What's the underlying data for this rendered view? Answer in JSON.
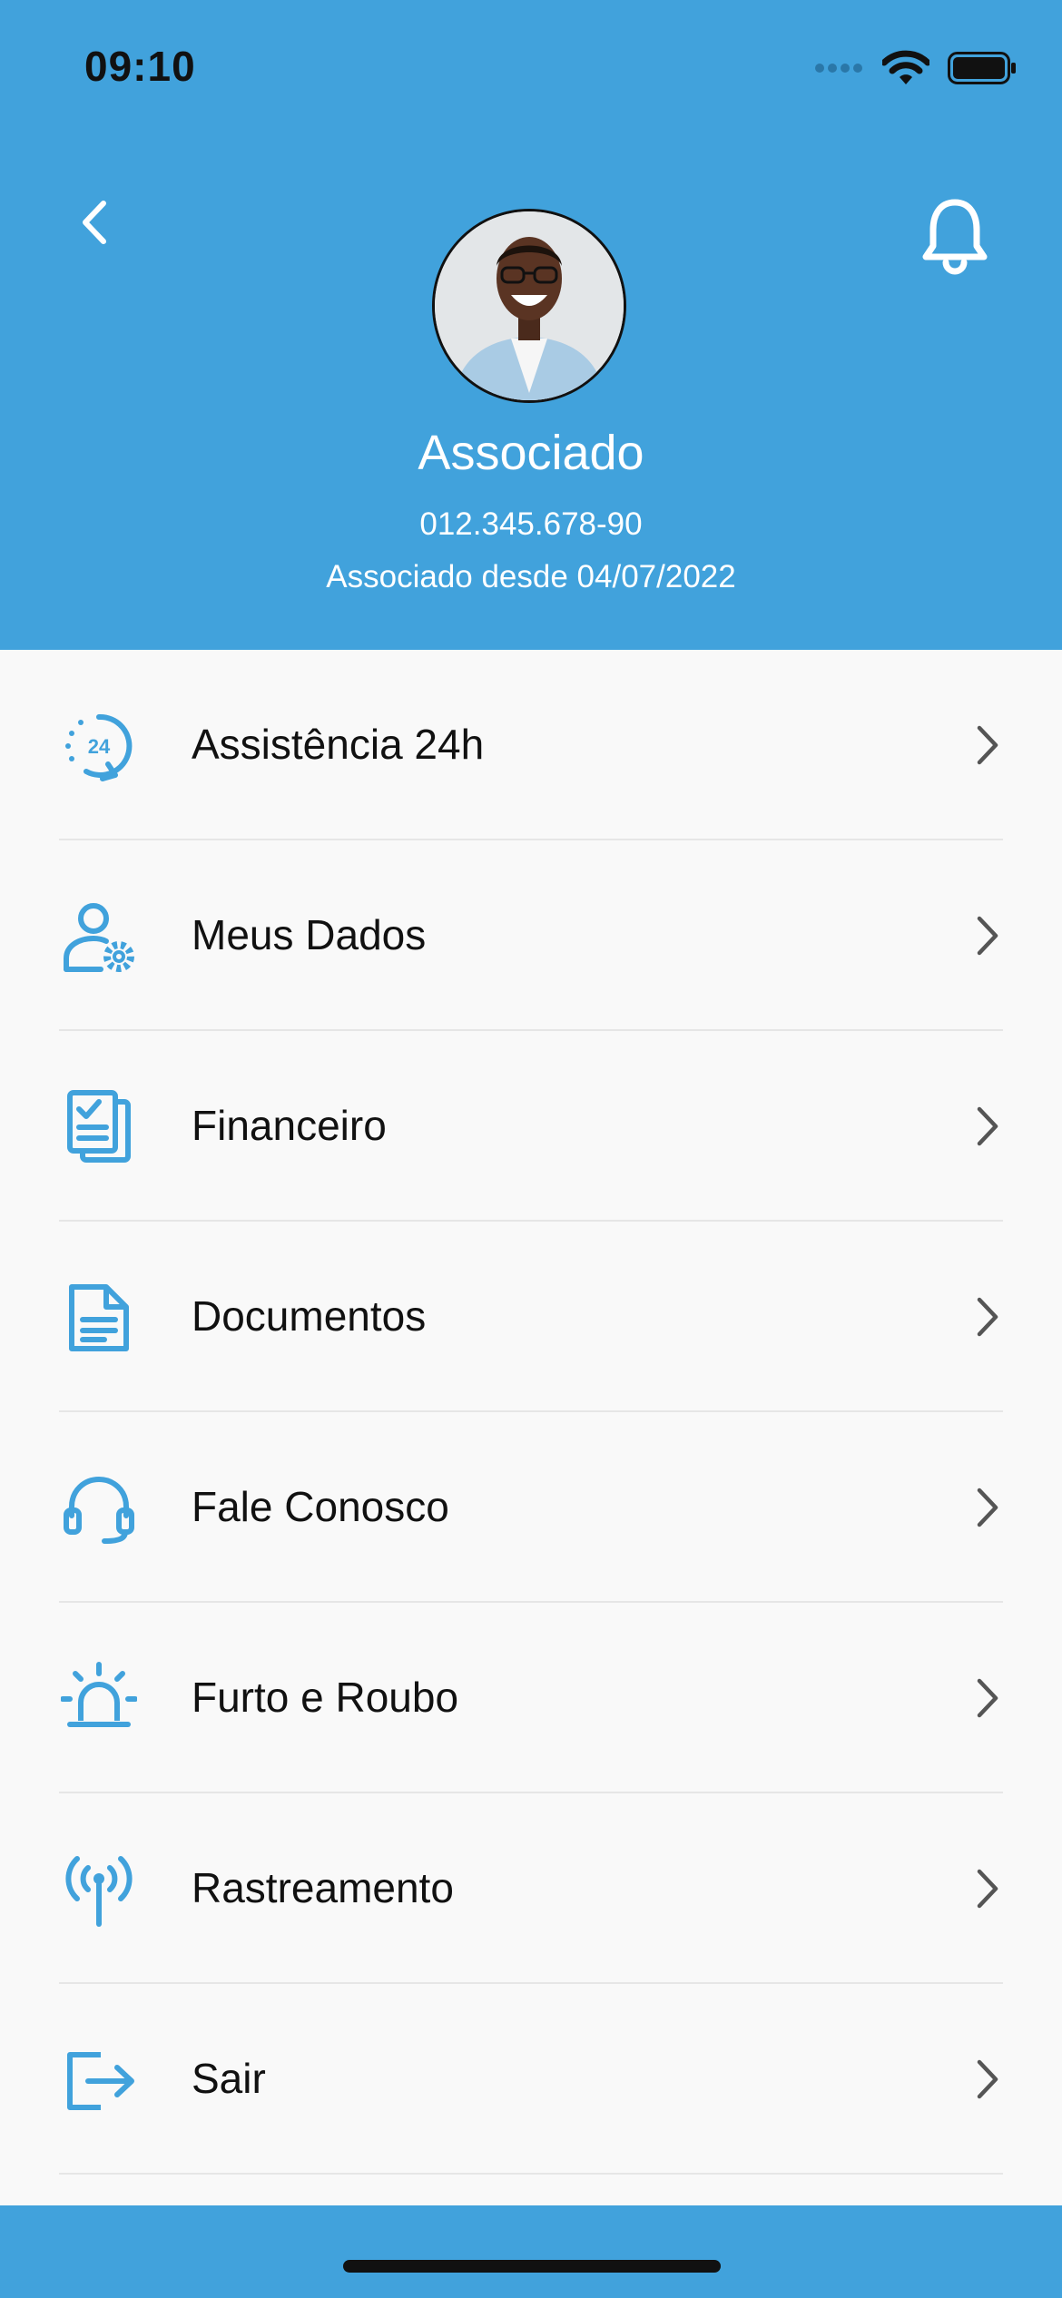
{
  "status_bar": {
    "time": "09:10"
  },
  "profile": {
    "name": "Associado",
    "cpf": "012.345.678-90",
    "member_since": "Associado desde 04/07/2022"
  },
  "colors": {
    "primary": "#41a2dc",
    "text": "#111111",
    "divider": "#e6e6e6",
    "background": "#f9f9f9"
  },
  "menu": {
    "items": [
      {
        "label": "Assistência 24h",
        "icon": "assistance-24h-icon"
      },
      {
        "label": "Meus Dados",
        "icon": "user-settings-icon"
      },
      {
        "label": "Financeiro",
        "icon": "financial-document-icon"
      },
      {
        "label": "Documentos",
        "icon": "document-icon"
      },
      {
        "label": "Fale Conosco",
        "icon": "headset-icon"
      },
      {
        "label": "Furto e Roubo",
        "icon": "siren-icon"
      },
      {
        "label": "Rastreamento",
        "icon": "tracking-antenna-icon"
      },
      {
        "label": "Sair",
        "icon": "logout-icon"
      }
    ]
  }
}
